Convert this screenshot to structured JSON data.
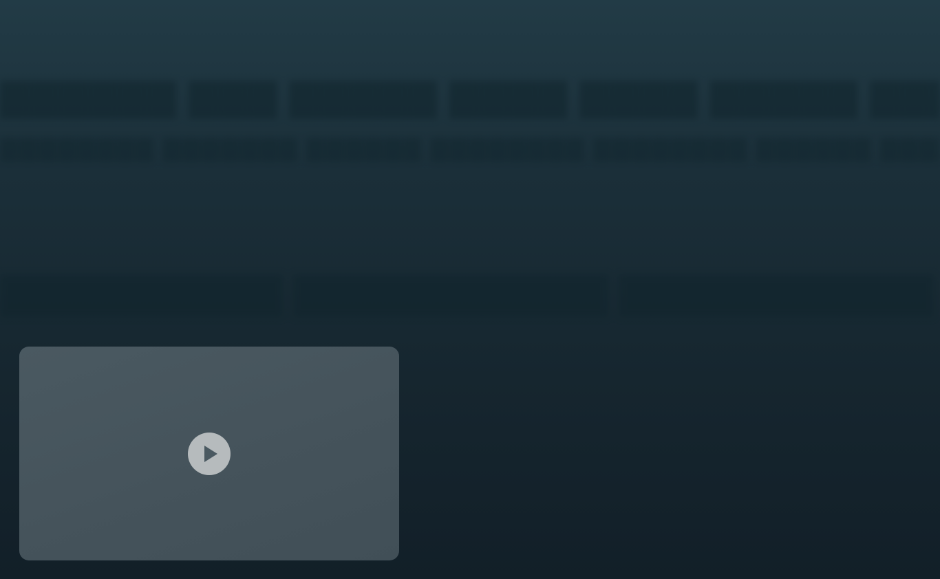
{
  "background": {
    "gradient_top": "#223b46",
    "gradient_bottom": "#121f28",
    "blurred_text_color": "#10242c"
  },
  "video_player": {
    "card_color": "#4a5961",
    "play_button_color": "#b6bbbd",
    "play_icon_color": "#4a5961",
    "play_icon": "play-icon"
  }
}
